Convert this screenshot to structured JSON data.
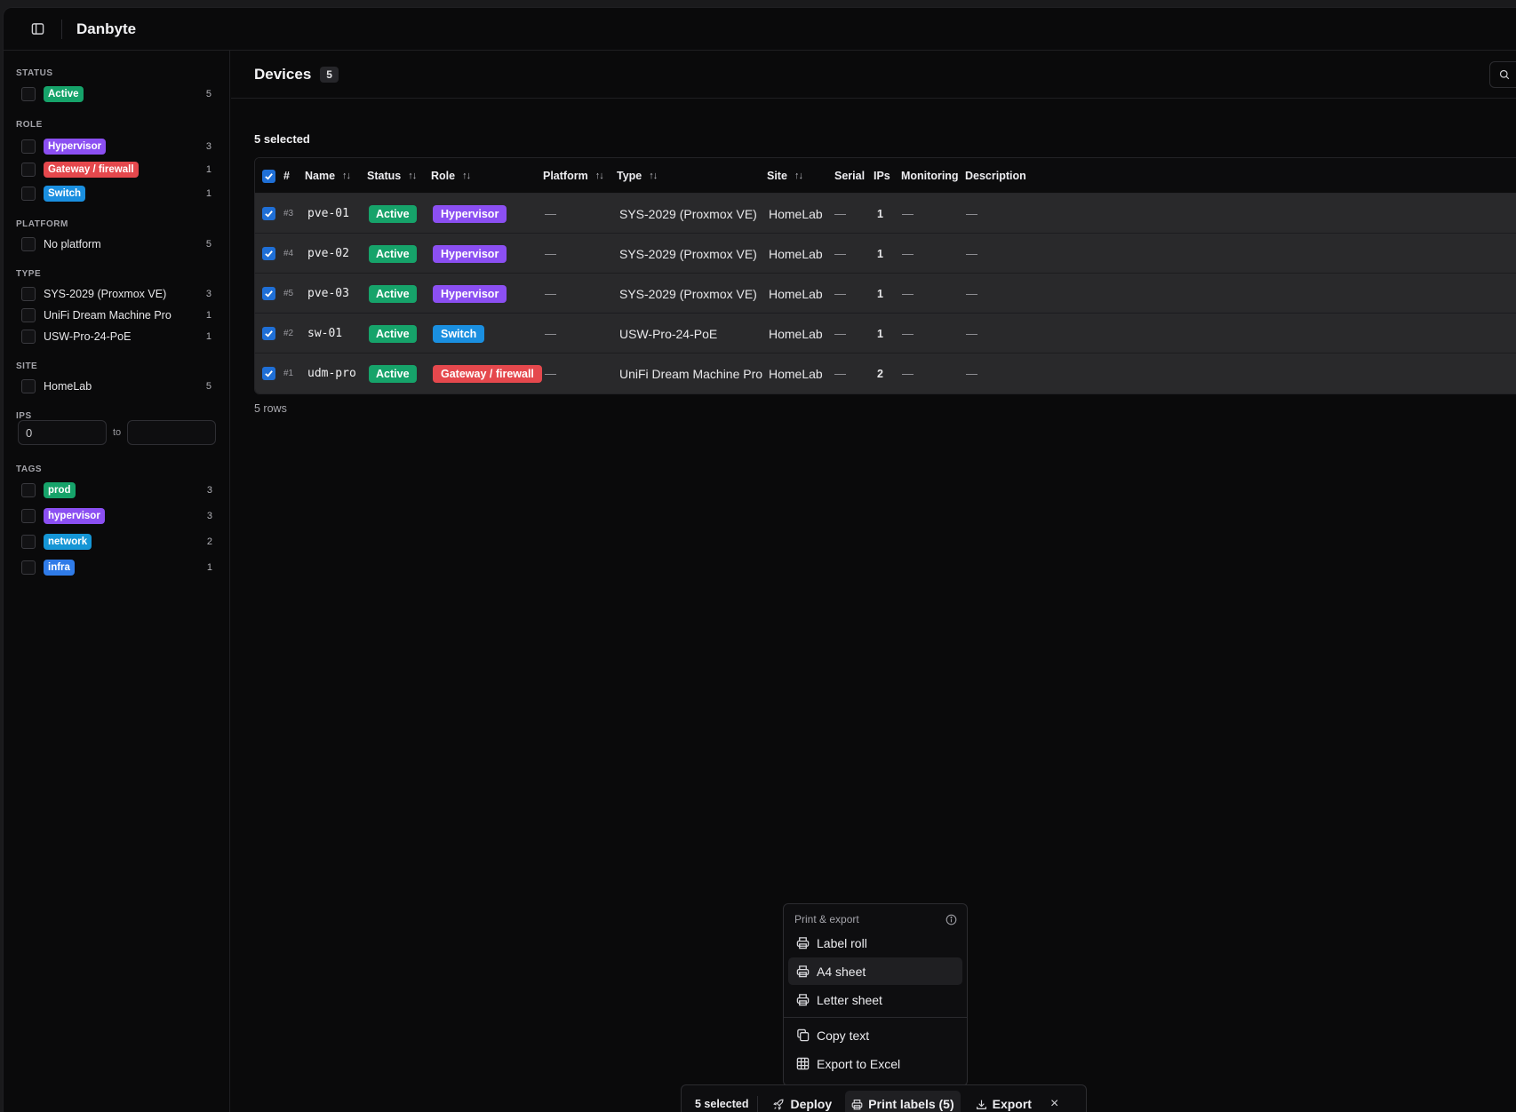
{
  "app": {
    "title": "Danbyte"
  },
  "filters": {
    "status": {
      "title": "Status",
      "items": [
        {
          "label": "Active",
          "count": "5"
        }
      ]
    },
    "role": {
      "title": "Role",
      "items": [
        {
          "label": "Hypervisor",
          "count": "3"
        },
        {
          "label": "Gateway / firewall",
          "count": "1"
        },
        {
          "label": "Switch",
          "count": "1"
        }
      ]
    },
    "platform": {
      "title": "Platform",
      "items": [
        {
          "label": "No platform",
          "count": "5"
        }
      ]
    },
    "type": {
      "title": "Type",
      "items": [
        {
          "label": "SYS-2029 (Proxmox VE)",
          "count": "3"
        },
        {
          "label": "UniFi Dream Machine Pro",
          "count": "1"
        },
        {
          "label": "USW-Pro-24-PoE",
          "count": "1"
        }
      ]
    },
    "site": {
      "title": "Site",
      "items": [
        {
          "label": "HomeLab",
          "count": "5"
        }
      ]
    },
    "ips": {
      "title": "IPs",
      "min_value": "0",
      "to_label": "to",
      "max_value": ""
    },
    "tags": {
      "title": "Tags",
      "items": [
        {
          "label": "prod",
          "count": "3"
        },
        {
          "label": "hypervisor",
          "count": "3"
        },
        {
          "label": "network",
          "count": "2"
        },
        {
          "label": "infra",
          "count": "1"
        }
      ]
    }
  },
  "main": {
    "title": "Devices",
    "count": "5",
    "selected_label": "5 selected",
    "rows_label": "5 rows"
  },
  "table": {
    "columns": {
      "id": "#",
      "name": "Name",
      "status": "Status",
      "role": "Role",
      "platform": "Platform",
      "type": "Type",
      "site": "Site",
      "serial": "Serial",
      "ips": "IPs",
      "monitoring": "Monitoring",
      "description": "Description"
    },
    "rows": [
      {
        "id": "#3",
        "name": "pve-01",
        "status": "Active",
        "role": "Hypervisor",
        "platform": "—",
        "type": "SYS-2029 (Proxmox VE)",
        "site": "HomeLab",
        "serial": "—",
        "ips": "1",
        "monitoring": "—",
        "description": "—"
      },
      {
        "id": "#4",
        "name": "pve-02",
        "status": "Active",
        "role": "Hypervisor",
        "platform": "—",
        "type": "SYS-2029 (Proxmox VE)",
        "site": "HomeLab",
        "serial": "—",
        "ips": "1",
        "monitoring": "—",
        "description": "—"
      },
      {
        "id": "#5",
        "name": "pve-03",
        "status": "Active",
        "role": "Hypervisor",
        "platform": "—",
        "type": "SYS-2029 (Proxmox VE)",
        "site": "HomeLab",
        "serial": "—",
        "ips": "1",
        "monitoring": "—",
        "description": "—"
      },
      {
        "id": "#2",
        "name": "sw-01",
        "status": "Active",
        "role": "Switch",
        "platform": "—",
        "type": "USW-Pro-24-PoE",
        "site": "HomeLab",
        "serial": "—",
        "ips": "1",
        "monitoring": "—",
        "description": "—"
      },
      {
        "id": "#1",
        "name": "udm-pro",
        "status": "Active",
        "role": "Gateway / firewall",
        "platform": "—",
        "type": "UniFi Dream Machine Pro",
        "site": "HomeLab",
        "serial": "—",
        "ips": "2",
        "monitoring": "—",
        "description": "—"
      }
    ]
  },
  "popover": {
    "title": "Print & export",
    "items": [
      {
        "label": "Label roll",
        "icon": "printer-icon"
      },
      {
        "label": "A4 sheet",
        "icon": "printer-icon"
      },
      {
        "label": "Letter sheet",
        "icon": "printer-icon"
      },
      {
        "label": "Copy text",
        "icon": "copy-icon"
      },
      {
        "label": "Export to Excel",
        "icon": "table-icon"
      }
    ]
  },
  "actionbar": {
    "selected": "5 selected",
    "deploy": "Deploy",
    "print_labels": "Print labels (5)",
    "export": "Export",
    "close": "×"
  },
  "colors": {
    "active": "#16a36a",
    "hypervisor": "#8b4ff2",
    "gateway": "#e5484d",
    "switch": "#1a8fe0",
    "checkbox": "#1f6fd6"
  }
}
